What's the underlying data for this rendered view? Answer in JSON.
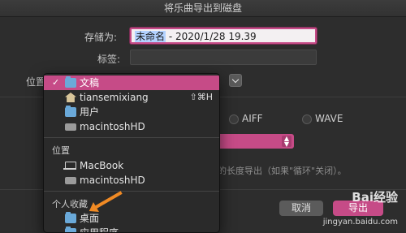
{
  "window": {
    "title": "将乐曲导出到磁盘"
  },
  "form": {
    "save_as_label": "存储为:",
    "save_as_value_selected": "未命名",
    "save_as_value_rest": " - 2020/1/28 19.39",
    "tags_label": "标签:",
    "location_label": "位置"
  },
  "formats": [
    "AIFF",
    "WAVE"
  ],
  "hint_text": "的长度导出（如果\"循环\"关闭）。",
  "buttons": {
    "cancel": "取消",
    "save": "导出"
  },
  "watermark": {
    "brand": "Bai经验",
    "url": "jingyan.baidu.com"
  },
  "menu": {
    "recent": [
      {
        "label": "文稿",
        "icon": "folder-icon",
        "selected": true
      },
      {
        "label": "tiansemixiang",
        "icon": "home-icon",
        "shortcut": "⇧⌘H"
      },
      {
        "label": "用户",
        "icon": "folder-icon"
      },
      {
        "label": "macintoshHD",
        "icon": "drive-icon"
      }
    ],
    "devices_header": "位置",
    "devices": [
      {
        "label": "MacBook",
        "icon": "laptop-icon"
      },
      {
        "label": "macintoshHD",
        "icon": "drive-icon"
      }
    ],
    "favorites_header": "个人收藏",
    "favorites": [
      {
        "label": "桌面",
        "icon": "folder-icon"
      },
      {
        "label": "应用程序",
        "icon": "folder-icon"
      }
    ]
  }
}
